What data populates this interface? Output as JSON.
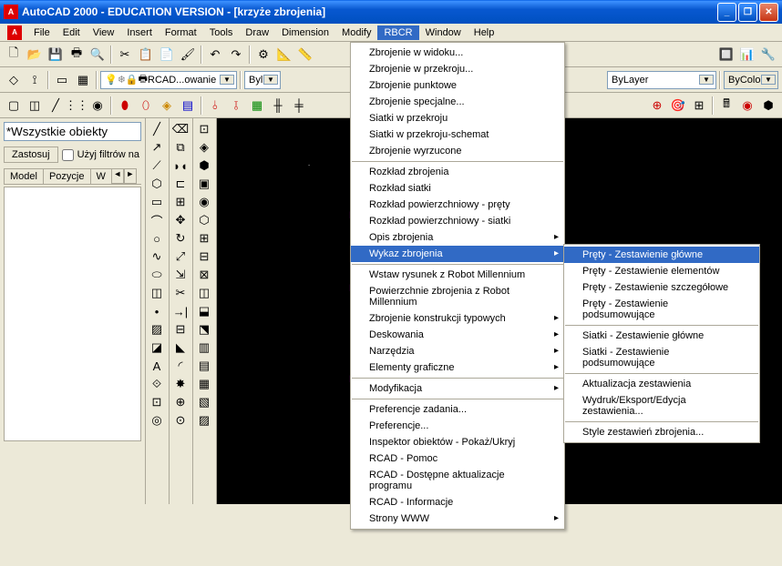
{
  "title": "AutoCAD 2000 - EDUCATION VERSION - [krzyże zbrojenia]",
  "menubar": [
    "File",
    "Edit",
    "View",
    "Insert",
    "Format",
    "Tools",
    "Draw",
    "Dimension",
    "Modify",
    "RBCR",
    "Window",
    "Help"
  ],
  "active_menu_index": 9,
  "toolbar_combos": {
    "layer": "RCAD...owanie",
    "linetype": "ByLayer",
    "color": "ByColor",
    "filter": "Byl"
  },
  "left_panel": {
    "search_value": "*Wszystkie obiekty",
    "apply_btn": "Zastosuj",
    "filter_cb": "Użyj filtrów na",
    "tabs": [
      "Model",
      "Pozycje",
      "W"
    ]
  },
  "main_menu_items": [
    {
      "label": "Zbrojenie w widoku...",
      "type": "item"
    },
    {
      "label": "Zbrojenie w przekroju...",
      "type": "item"
    },
    {
      "label": "Zbrojenie punktowe",
      "type": "item"
    },
    {
      "label": "Zbrojenie specjalne...",
      "type": "item"
    },
    {
      "label": "Siatki w przekroju",
      "type": "item"
    },
    {
      "label": "Siatki w przekroju-schemat",
      "type": "item"
    },
    {
      "label": "Zbrojenie wyrzucone",
      "type": "item"
    },
    {
      "type": "sep"
    },
    {
      "label": "Rozkład zbrojenia",
      "type": "item"
    },
    {
      "label": "Rozkład siatki",
      "type": "item"
    },
    {
      "label": "Rozkład powierzchniowy - pręty",
      "type": "item"
    },
    {
      "label": "Rozkład powierzchniowy - siatki",
      "type": "item"
    },
    {
      "label": "Opis zbrojenia",
      "type": "sub"
    },
    {
      "label": "Wykaz zbrojenia",
      "type": "sub",
      "highlight": true
    },
    {
      "type": "sep"
    },
    {
      "label": "Wstaw rysunek z Robot Millennium",
      "type": "item"
    },
    {
      "label": "Powierzchnie zbrojenia z Robot Millennium",
      "type": "item"
    },
    {
      "label": "Zbrojenie konstrukcji typowych",
      "type": "sub"
    },
    {
      "label": "Deskowania",
      "type": "sub"
    },
    {
      "label": "Narzędzia",
      "type": "sub"
    },
    {
      "label": "Elementy graficzne",
      "type": "sub"
    },
    {
      "type": "sep"
    },
    {
      "label": "Modyfikacja",
      "type": "sub"
    },
    {
      "type": "sep"
    },
    {
      "label": "Preferencje zadania...",
      "type": "item"
    },
    {
      "label": "Preferencje...",
      "type": "item"
    },
    {
      "label": "Inspektor obiektów - Pokaż/Ukryj",
      "type": "item"
    },
    {
      "label": "RCAD - Pomoc",
      "type": "item"
    },
    {
      "label": "RCAD - Dostępne aktualizacje programu",
      "type": "item"
    },
    {
      "label": "RCAD - Informacje",
      "type": "item"
    },
    {
      "label": "Strony WWW",
      "type": "sub"
    }
  ],
  "sub_menu_items": [
    {
      "label": "Pręty - Zestawienie główne",
      "highlight": true
    },
    {
      "label": "Pręty - Zestawienie elementów"
    },
    {
      "label": "Pręty - Zestawienie szczegółowe"
    },
    {
      "label": "Pręty - Zestawienie podsumowujące"
    },
    {
      "type": "sep"
    },
    {
      "label": "Siatki - Zestawienie główne"
    },
    {
      "label": "Siatki - Zestawienie podsumowujące"
    },
    {
      "type": "sep"
    },
    {
      "label": "Aktualizacja zestawienia"
    },
    {
      "label": "Wydruk/Eksport/Edycja zestawienia..."
    },
    {
      "type": "sep"
    },
    {
      "label": "Style zestawień zbrojenia..."
    }
  ]
}
